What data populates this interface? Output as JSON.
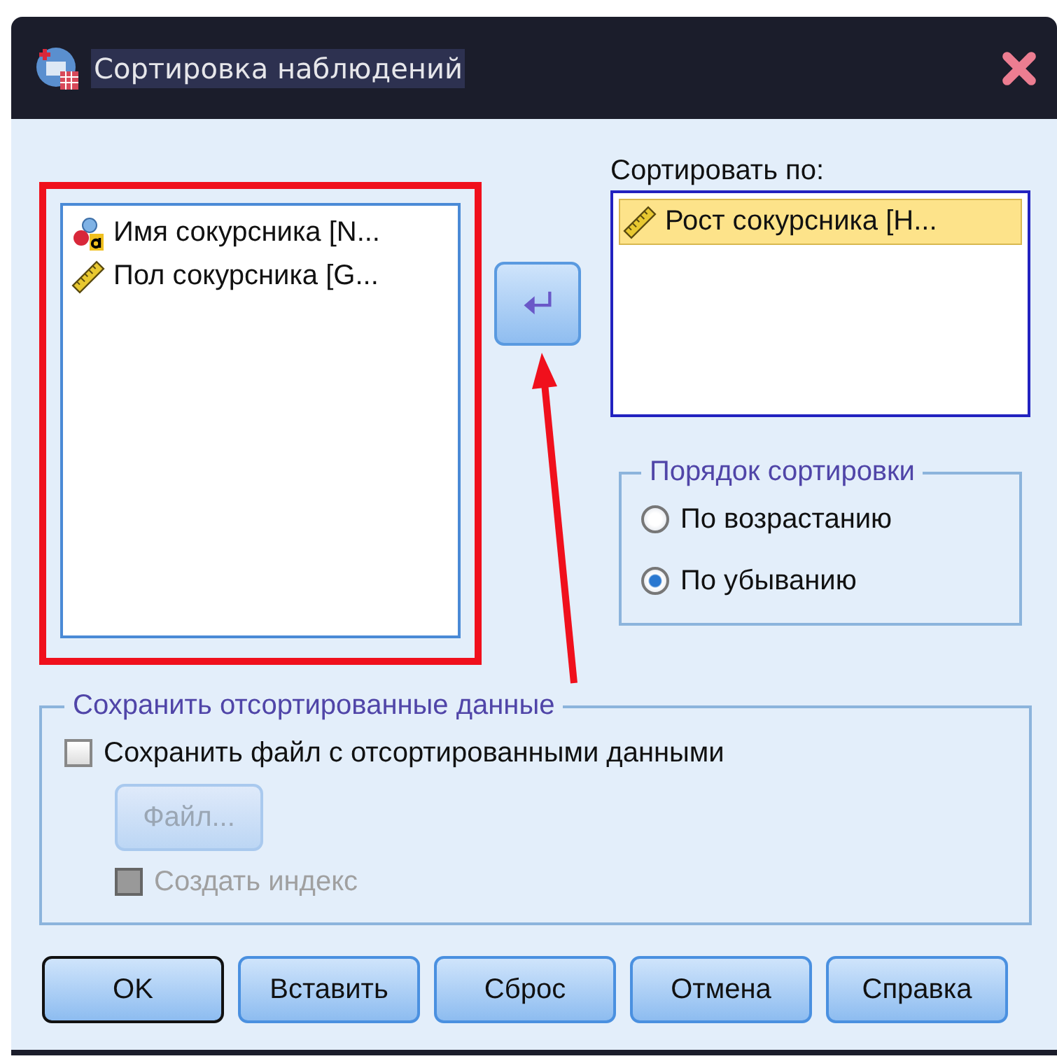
{
  "window": {
    "title": "Сортировка наблюдений"
  },
  "variables": [
    {
      "label": "Имя сокурсника [N...",
      "kind": "nominal"
    },
    {
      "label": "Пол сокурсника [G...",
      "kind": "scale"
    }
  ],
  "sort_by": {
    "label": "Сортировать по:",
    "items": [
      {
        "label": "Рост сокурсника [H...",
        "kind": "scale",
        "selected": true
      }
    ]
  },
  "sort_order": {
    "title": "Порядок сортировки",
    "options": [
      {
        "label": "По возрастанию",
        "selected": false
      },
      {
        "label": "По убыванию",
        "selected": true
      }
    ]
  },
  "save_group": {
    "title": "Сохранить отсортированные данные",
    "save_file": {
      "label": "Сохранить файл с отсортированными данными",
      "checked": false
    },
    "file_button": {
      "label": "Файл...",
      "disabled": true
    },
    "create_index": {
      "label": "Создать индекс",
      "checked": false,
      "disabled": true
    }
  },
  "buttons": [
    {
      "label": "OK",
      "default": true
    },
    {
      "label": "Вставить",
      "default": false
    },
    {
      "label": "Сброс",
      "default": false
    },
    {
      "label": "Отмена",
      "default": false
    },
    {
      "label": "Справка",
      "default": false
    }
  ],
  "annotation": {
    "highlight": true,
    "arrow": true
  }
}
